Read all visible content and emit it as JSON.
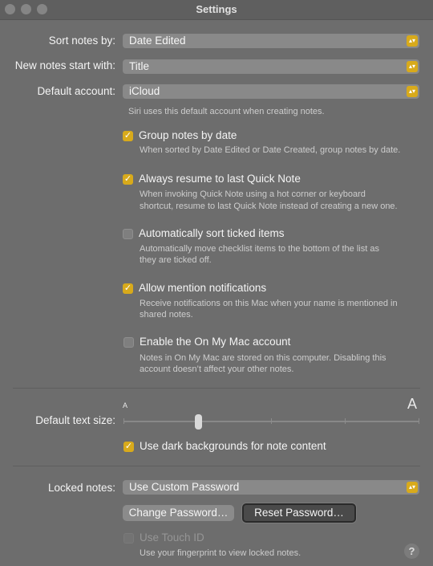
{
  "window": {
    "title": "Settings"
  },
  "sort": {
    "label": "Sort notes by:",
    "value": "Date Edited"
  },
  "new_notes": {
    "label": "New notes start with:",
    "value": "Title"
  },
  "account": {
    "label": "Default account:",
    "value": "iCloud",
    "hint": "Siri uses this default account when creating notes."
  },
  "options": [
    {
      "label": "Group notes by date",
      "checked": true,
      "hint": [
        "When sorted by Date Edited or Date Created, group notes by date."
      ]
    },
    {
      "label": "Always resume to last Quick Note",
      "checked": true,
      "hint": [
        "When invoking Quick Note using a hot corner or keyboard",
        "shortcut, resume to last Quick Note instead of creating a new one."
      ]
    },
    {
      "label": "Automatically sort ticked items",
      "checked": false,
      "hint": [
        "Automatically move checklist items to the bottom of the list as",
        "they are ticked off."
      ]
    },
    {
      "label": "Allow mention notifications",
      "checked": true,
      "hint": [
        "Receive notifications on this Mac when your name is mentioned in",
        "shared notes."
      ]
    },
    {
      "label": "Enable the On My Mac account",
      "checked": false,
      "hint": [
        "Notes in On My Mac are stored on this computer. Disabling this",
        "account doesn’t affect your other notes."
      ]
    }
  ],
  "text_size": {
    "label": "Default text size:",
    "small_glyph": "A",
    "large_glyph": "A",
    "level_step": 1,
    "steps": 5
  },
  "dark_backgrounds": {
    "label": "Use dark backgrounds for note content",
    "checked": true
  },
  "locked": {
    "label": "Locked notes:",
    "value": "Use Custom Password",
    "change_label": "Change Password…",
    "reset_label": "Reset Password…",
    "touch_id_label": "Use Touch ID",
    "touch_id_hint": "Use your fingerprint to view locked notes."
  },
  "help": {
    "glyph": "?"
  },
  "colors": {
    "accent": "#d8aa1b",
    "background": "#6d6d6d"
  },
  "icons": {
    "stepper": "chevron-up-down-icon",
    "check": "checkmark-icon",
    "help": "question-icon"
  }
}
